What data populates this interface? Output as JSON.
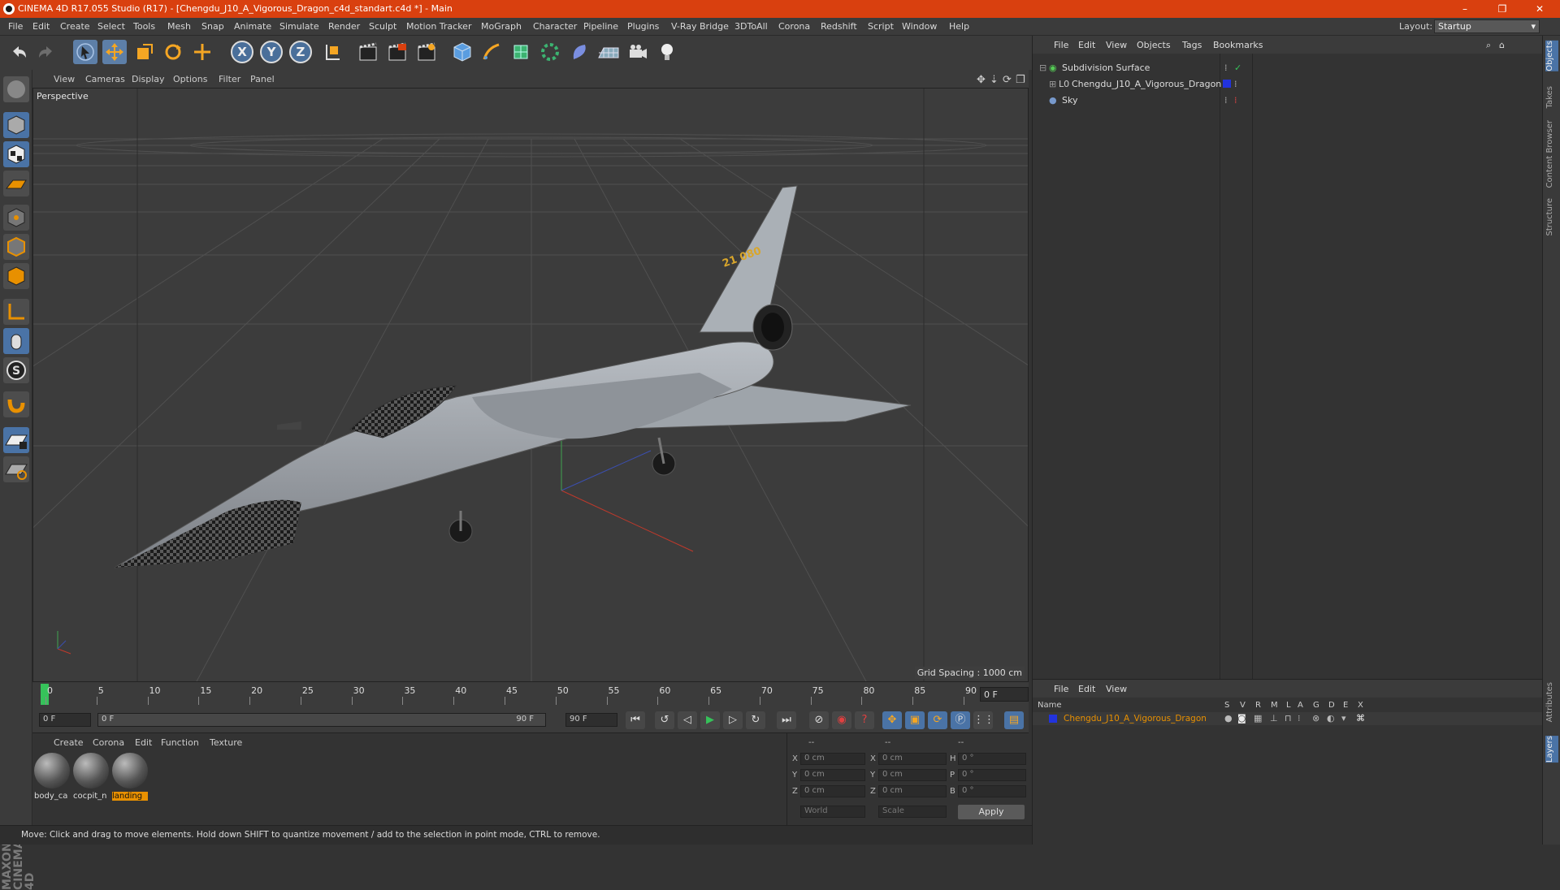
{
  "window": {
    "title": "CINEMA 4D R17.055 Studio (R17) - [Chengdu_J10_A_Vigorous_Dragon_c4d_standart.c4d *] - Main",
    "controls": [
      "–",
      "❐",
      "✕"
    ]
  },
  "menubar": {
    "items": [
      "File",
      "Edit",
      "Create",
      "Select",
      "Tools",
      "Mesh",
      "Snap",
      "Animate",
      "Simulate",
      "Render",
      "Sculpt",
      "Motion Tracker",
      "MoGraph",
      "Character",
      "Pipeline",
      "Plugins",
      "V-Ray Bridge",
      "3DToAll",
      "Corona",
      "Redshift",
      "Script",
      "Window",
      "Help"
    ],
    "layout_label": "Layout:",
    "layout_value": "Startup"
  },
  "toolbar": {
    "axis_x": "X",
    "axis_y": "Y",
    "axis_z": "Z",
    "icons": [
      "undo-icon",
      "redo-icon",
      "select-icon",
      "move-icon",
      "scale-icon",
      "rotate-icon",
      "transform-icon",
      "axis-x-icon",
      "axis-y-icon",
      "axis-z-icon",
      "coord-system-icon",
      "render-view-icon",
      "render-picture-viewer-icon",
      "render-settings-icon",
      "cube-icon",
      "pen-icon",
      "subdivision-icon",
      "cloner-icon",
      "deformer-icon",
      "floor-icon",
      "camera-icon",
      "light-icon"
    ]
  },
  "viewport": {
    "menu": [
      "View",
      "Cameras",
      "Display",
      "Options",
      "Filter",
      "Panel"
    ],
    "label": "Perspective",
    "grid_spacing": "Grid Spacing : 1000 cm",
    "model_marking": "21 080"
  },
  "timeline": {
    "ticks": [
      "0",
      "5",
      "10",
      "15",
      "20",
      "25",
      "30",
      "35",
      "40",
      "45",
      "50",
      "55",
      "60",
      "65",
      "70",
      "75",
      "80",
      "85",
      "90"
    ],
    "current_frame": "0 F",
    "start_field": "0 F",
    "range_start": "0 F",
    "range_end": "90 F",
    "end_field": "90 F"
  },
  "materials": {
    "menu": [
      "Create",
      "Corona",
      "Edit",
      "Function",
      "Texture"
    ],
    "items": [
      {
        "label": "body_ca",
        "selected": false
      },
      {
        "label": "cocpit_n",
        "selected": false
      },
      {
        "label": "landing",
        "selected": true
      }
    ]
  },
  "coordinates": {
    "header": [
      "--",
      "--",
      "--"
    ],
    "rows": [
      {
        "a": "X",
        "av": "0 cm",
        "b": "X",
        "bv": "0 cm",
        "c": "H",
        "cv": "0 °"
      },
      {
        "a": "Y",
        "av": "0 cm",
        "b": "Y",
        "bv": "0 cm",
        "c": "P",
        "cv": "0 °"
      },
      {
        "a": "Z",
        "av": "0 cm",
        "b": "Z",
        "bv": "0 cm",
        "c": "B",
        "cv": "0 °"
      }
    ],
    "mode1": "World",
    "mode2": "Scale",
    "apply": "Apply"
  },
  "status": "Move: Click and drag to move elements. Hold down SHIFT to quantize movement / add to the selection in point mode, CTRL to remove.",
  "objects": {
    "menu": [
      "File",
      "Edit",
      "View",
      "Objects",
      "Tags",
      "Bookmarks"
    ],
    "items": [
      {
        "name": "Subdivision Surface",
        "color": "#55cc55"
      },
      {
        "name": "Chengdu_J10_A_Vigorous_Dragon",
        "color": "#2233dd"
      },
      {
        "name": "Sky",
        "color": "#7799cc"
      }
    ]
  },
  "layers": {
    "menu": [
      "File",
      "Edit",
      "View"
    ],
    "name_header": "Name",
    "flags": [
      "S",
      "V",
      "R",
      "M",
      "L",
      "A",
      "G",
      "D",
      "E",
      "X"
    ],
    "row": "Chengdu_J10_A_Vigorous_Dragon",
    "accent": "#e89000"
  },
  "right_tabs": [
    "Objects",
    "Takes",
    "Content Browser",
    "Structure",
    "Attributes",
    "Layers"
  ],
  "brand": "MAXON CINEMA 4D"
}
